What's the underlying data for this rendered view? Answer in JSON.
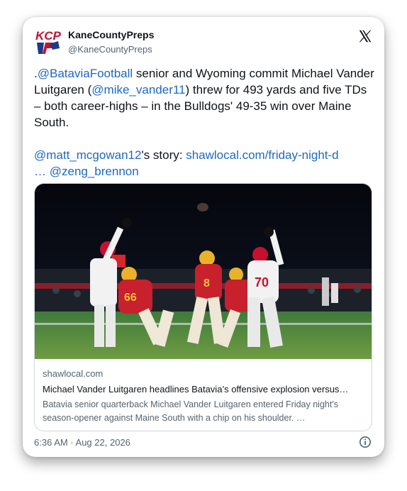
{
  "author": {
    "name": "KaneCountyPreps",
    "handle": "@KaneCountyPreps",
    "avatar_text": "KCP",
    "avatar_color": "#c8102e"
  },
  "tweet": {
    "p1_prefix": ".",
    "p1_mention_team": "@BataviaFootball",
    "p1_text_a": " senior and Wyoming commit Michael Vander Luitgaren (",
    "p1_mention_player": "@mike_vander11",
    "p1_text_b": ") threw for 493 yards and five TDs – both career-highs – in the Bulldogs' 49-35 win over Maine South.",
    "p2_mention_writer": "@matt_mcgowan12",
    "p2_text": "'s story: ",
    "p2_link": "shawlocal.com/friday-night-d",
    "p2_ellipsis": "… ",
    "p2_mention_photo": "@zeng_brennon"
  },
  "card": {
    "domain": "shawlocal.com",
    "headline": "Michael Vander Luitgaren headlines Batavia’s offensive explosion versus…",
    "description": "Batavia senior quarterback Michael Vander Luitgaren entered Friday night's season-opener against Maine South with a chip on his shoulder. …",
    "image_jersey_numbers": [
      "66",
      "8",
      "70"
    ]
  },
  "meta": {
    "timestamp": "6:36 AM · Aug 22, 2026"
  },
  "icons": {
    "platform": "x-logo-icon",
    "info": "info-icon"
  },
  "colors": {
    "link": "#1d68c2",
    "text": "#0f1419",
    "secondary": "#536471"
  }
}
